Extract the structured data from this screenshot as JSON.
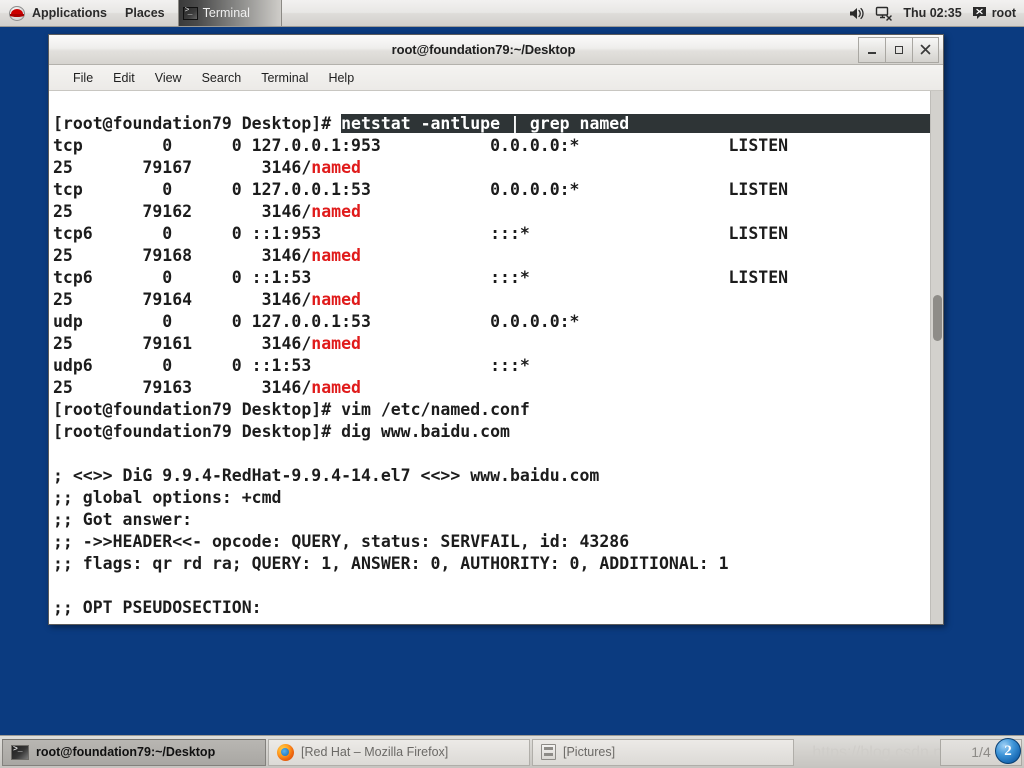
{
  "top_panel": {
    "logo_icon": "redhat-logo-icon",
    "applications_label": "Applications",
    "places_label": "Places",
    "window_list": [
      {
        "label": "Terminal",
        "icon": "terminal-icon"
      }
    ],
    "tray": {
      "volume_icon": "speaker-volume-icon",
      "network_icon": "network-disconnected-icon",
      "clock": "Thu 02:35",
      "user_icon": "user-account-icon",
      "user_label": "root"
    }
  },
  "terminal_window": {
    "title": "root@foundation79:~/Desktop",
    "window_buttons": {
      "minimize": "_",
      "maximize": "□",
      "close": "✕"
    },
    "menus": [
      "File",
      "Edit",
      "View",
      "Search",
      "Terminal",
      "Help"
    ],
    "prompt": "[root@foundation79 Desktop]#",
    "lines": [
      {
        "type": "prompt_highlight",
        "prompt": "[root@foundation79 Desktop]# ",
        "command": "netstat -antlupe | grep named"
      },
      {
        "type": "plain",
        "text": "tcp        0      0 127.0.0.1:953           0.0.0.0:*               LISTEN"
      },
      {
        "type": "named",
        "pre": "25       79167       3146/",
        "proc": "named"
      },
      {
        "type": "plain",
        "text": "tcp        0      0 127.0.0.1:53            0.0.0.0:*               LISTEN"
      },
      {
        "type": "named",
        "pre": "25       79162       3146/",
        "proc": "named"
      },
      {
        "type": "plain",
        "text": "tcp6       0      0 ::1:953                 :::*                    LISTEN"
      },
      {
        "type": "named",
        "pre": "25       79168       3146/",
        "proc": "named"
      },
      {
        "type": "plain",
        "text": "tcp6       0      0 ::1:53                  :::*                    LISTEN"
      },
      {
        "type": "named",
        "pre": "25       79164       3146/",
        "proc": "named"
      },
      {
        "type": "plain",
        "text": "udp        0      0 127.0.0.1:53            0.0.0.0:*"
      },
      {
        "type": "named",
        "pre": "25       79161       3146/",
        "proc": "named"
      },
      {
        "type": "plain",
        "text": "udp6       0      0 ::1:53                  :::*"
      },
      {
        "type": "named",
        "pre": "25       79163       3146/",
        "proc": "named"
      },
      {
        "type": "plain",
        "text": "[root@foundation79 Desktop]# vim /etc/named.conf"
      },
      {
        "type": "plain",
        "text": "[root@foundation79 Desktop]# dig www.baidu.com"
      },
      {
        "type": "plain",
        "text": ""
      },
      {
        "type": "plain",
        "text": "; <<>> DiG 9.9.4-RedHat-9.9.4-14.el7 <<>> www.baidu.com"
      },
      {
        "type": "plain",
        "text": ";; global options: +cmd"
      },
      {
        "type": "plain",
        "text": ";; Got answer:"
      },
      {
        "type": "plain",
        "text": ";; ->>HEADER<<- opcode: QUERY, status: SERVFAIL, id: 43286"
      },
      {
        "type": "plain",
        "text": ";; flags: qr rd ra; QUERY: 1, ANSWER: 0, AUTHORITY: 0, ADDITIONAL: 1"
      },
      {
        "type": "plain",
        "text": ""
      },
      {
        "type": "plain",
        "text": ";; OPT PSEUDOSECTION:"
      }
    ]
  },
  "bottom_panel": {
    "tasks": [
      {
        "label": "root@foundation79:~/Desktop",
        "icon": "terminal-icon",
        "active": true
      },
      {
        "label": "[Red Hat – Mozilla Firefox]",
        "icon": "firefox-icon",
        "active": false
      },
      {
        "label": "[Pictures]",
        "icon": "file-manager-icon",
        "active": false
      }
    ],
    "watermark": "https://blog.csdn.net/",
    "workspace": "1/4",
    "workspace_badge": "2"
  },
  "colors": {
    "desktop_blue": "#0b3b80",
    "named_red": "#e01b1b",
    "highlight_bg": "#2e3436",
    "panel_gray": "#d3d1cd"
  }
}
